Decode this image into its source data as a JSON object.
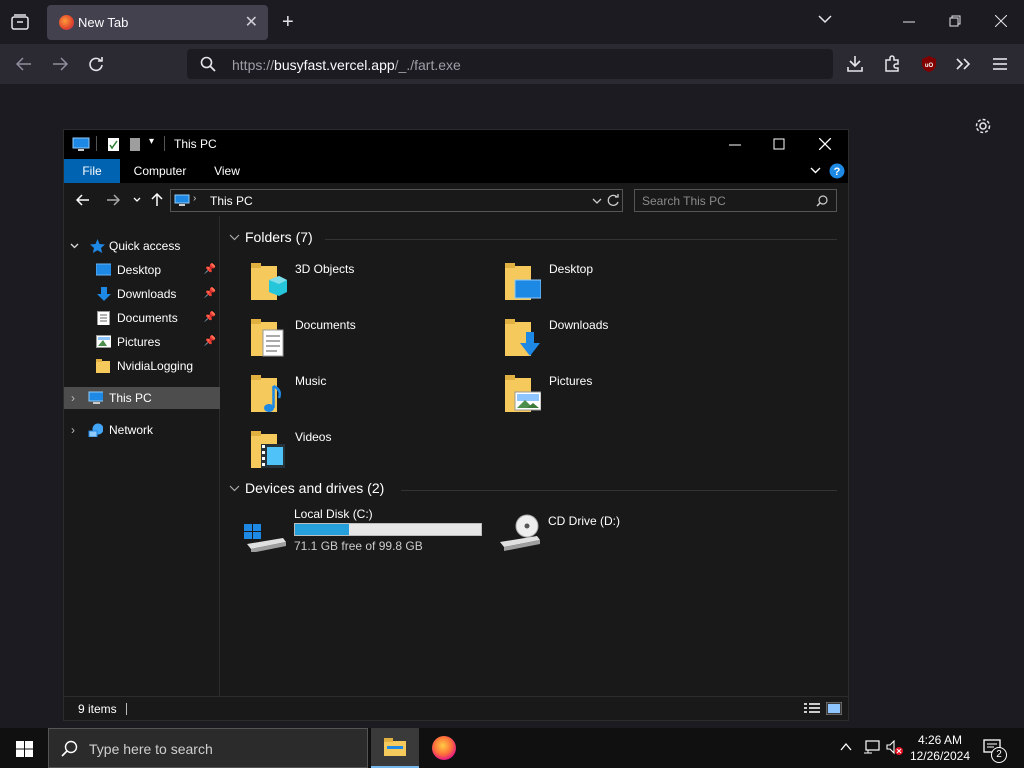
{
  "browser": {
    "tab_title": "New Tab",
    "url_prefix": "https://",
    "url_host": "busyfast.vercel.app",
    "url_path": "/_./fart.exe"
  },
  "explorer": {
    "title": "This PC",
    "ribbon_tabs": [
      "File",
      "Computer",
      "View"
    ],
    "address": "This PC",
    "search_placeholder": "Search This PC",
    "nav": {
      "quick_access": "Quick access",
      "items": [
        "Desktop",
        "Downloads",
        "Documents",
        "Pictures",
        "NvidiaLogging"
      ],
      "this_pc": "This PC",
      "network": "Network"
    },
    "folders_header": "Folders (7)",
    "folders": [
      "3D Objects",
      "Desktop",
      "Documents",
      "Downloads",
      "Music",
      "Pictures",
      "Videos"
    ],
    "drives_header": "Devices and drives (2)",
    "drives": [
      {
        "name": "Local Disk (C:)",
        "free": "71.1 GB free of 99.8 GB",
        "used_fraction": 0.288
      },
      {
        "name": "CD Drive (D:)"
      }
    ],
    "status": "9 items"
  },
  "taskbar": {
    "search_placeholder": "Type here to search",
    "time": "4:26 AM",
    "date": "12/26/2024",
    "notification_count": "2"
  },
  "colors": {
    "accent": "#0063b1",
    "folder_yellow": "#f5c95b",
    "drive_bar": "#26a0da"
  }
}
